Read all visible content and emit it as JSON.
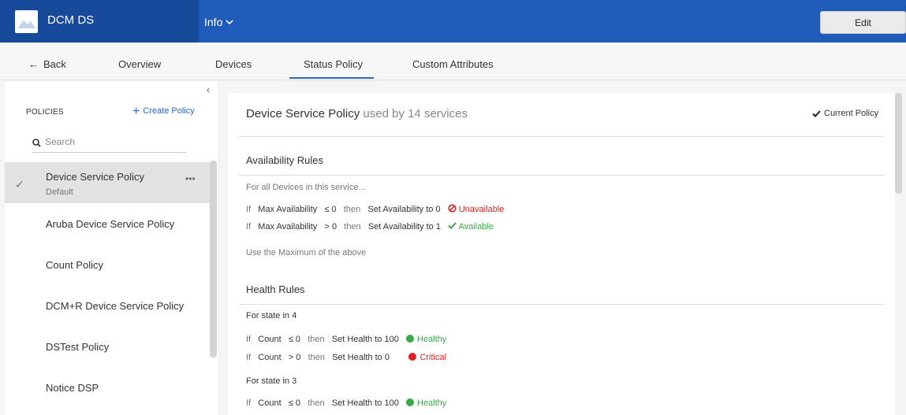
{
  "header": {
    "app_title": "DCM DS",
    "info_menu": "Info",
    "edit_label": "Edit"
  },
  "tabs": {
    "back": "Back",
    "items": [
      "Overview",
      "Devices",
      "Status Policy",
      "Custom Attributes"
    ],
    "active": "Status Policy"
  },
  "sidebar": {
    "policies_label": "POLICIES",
    "create_policy": "Create Policy",
    "search_placeholder": "Search",
    "items": [
      {
        "name": "Device Service Policy",
        "sub": "Default",
        "selected": true
      },
      {
        "name": "Aruba Device Service Policy"
      },
      {
        "name": "Count Policy"
      },
      {
        "name": "DCM+R Device Service Policy"
      },
      {
        "name": "DSTest Policy"
      },
      {
        "name": "Notice DSP"
      }
    ]
  },
  "main": {
    "policy_name": "Device Service Policy",
    "used_by_text": "used by 14 services",
    "current_policy": "Current Policy",
    "availability": {
      "title": "Availability Rules",
      "intro": "For all Devices in this service...",
      "rules": [
        {
          "if": "If",
          "metric": "Max Availability",
          "op": "≤ 0",
          "then": "then",
          "action": "Set Availability to 0",
          "status": "Unavailable"
        },
        {
          "if": "If",
          "metric": "Max Availability",
          "op": "> 0",
          "then": "then",
          "action": "Set Availability to 1",
          "status": "Available"
        }
      ],
      "footer": "Use the Maximum of the above"
    },
    "health": {
      "title": "Health Rules",
      "groups": [
        {
          "heading": "For state in 4",
          "rules": [
            {
              "if": "If",
              "metric": "Count",
              "op": "≤ 0",
              "then": "then",
              "action": "Set Health to 100",
              "status": "Healthy"
            },
            {
              "if": "If",
              "metric": "Count",
              "op": "> 0",
              "then": "then",
              "action": "Set Health to 0",
              "status": "Critical"
            }
          ]
        },
        {
          "heading": "For state in 3",
          "rules": [
            {
              "if": "If",
              "metric": "Count",
              "op": "≤ 0",
              "then": "then",
              "action": "Set Health to 100",
              "status": "Healthy"
            }
          ]
        }
      ]
    }
  },
  "colors": {
    "brand": "#1f5bb8",
    "accent": "#2e69c7",
    "critical": "#e02020",
    "healthy": "#3aa84a"
  }
}
